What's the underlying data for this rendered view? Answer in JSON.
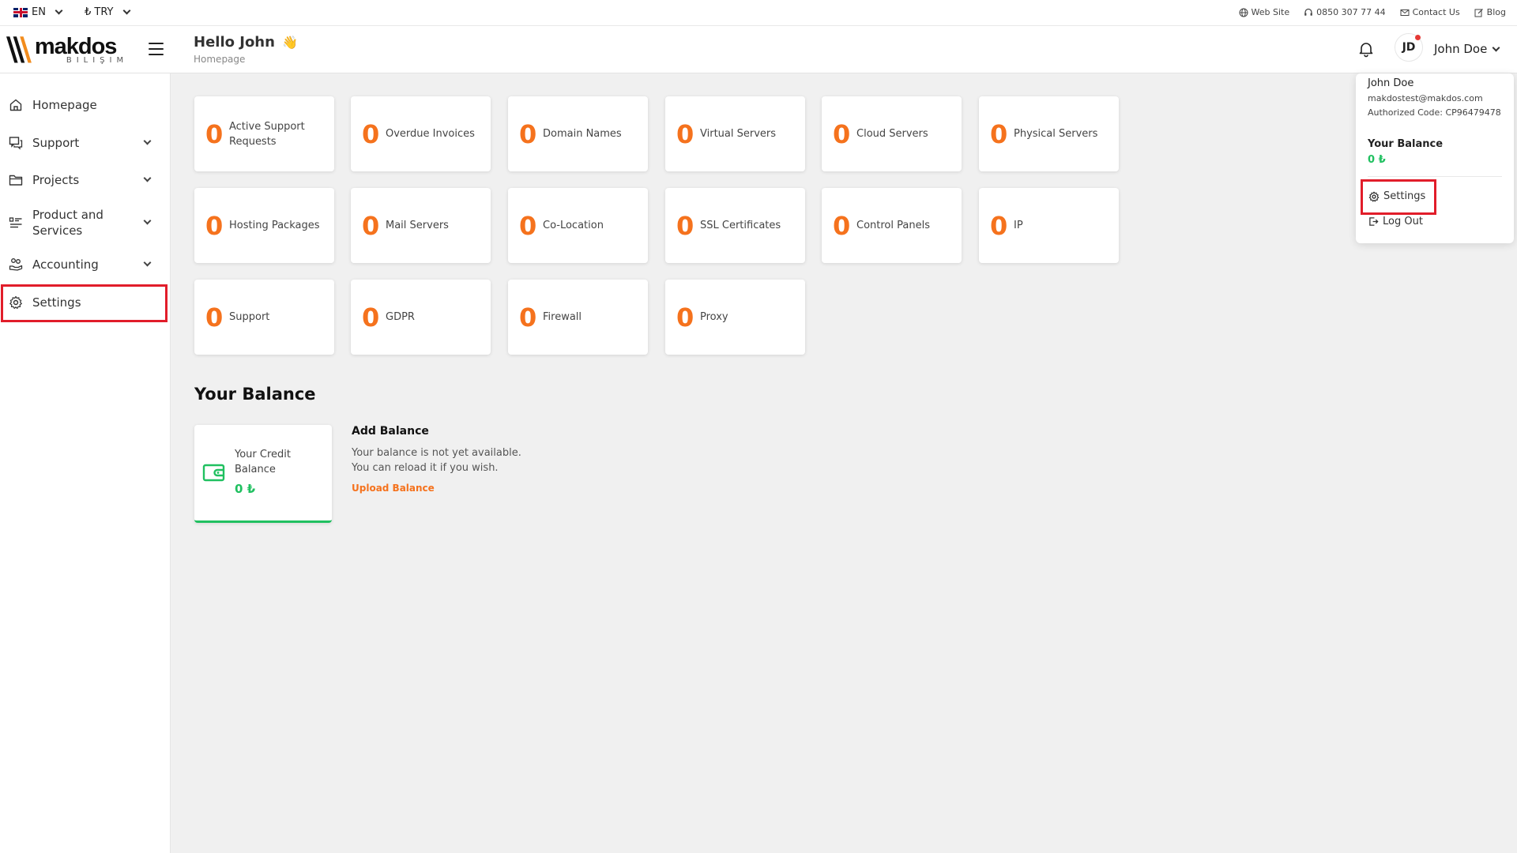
{
  "topbar": {
    "language": "EN",
    "currency": "₺ TRY",
    "links": {
      "website": "Web Site",
      "phone": "0850 307 77 44",
      "contact": "Contact Us",
      "blog": "Blog"
    }
  },
  "header": {
    "logo_brand": "makdos",
    "logo_sub": "BILIŞIM",
    "greeting": "Hello John",
    "greeting_emoji": "👋",
    "breadcrumb": "Homepage",
    "avatar_initials": "JD",
    "user_name": "John Doe"
  },
  "sidebar": {
    "items": [
      {
        "label": "Homepage",
        "icon": "home-icon",
        "has_submenu": false
      },
      {
        "label": "Support",
        "icon": "chat-icon",
        "has_submenu": true
      },
      {
        "label": "Projects",
        "icon": "folder-icon",
        "has_submenu": true
      },
      {
        "label": "Product and Services",
        "icon": "list-icon",
        "has_submenu": true
      },
      {
        "label": "Accounting",
        "icon": "coins-hand-icon",
        "has_submenu": true
      },
      {
        "label": "Settings",
        "icon": "gear-icon",
        "has_submenu": false,
        "highlighted": true
      }
    ]
  },
  "stats": [
    {
      "value": "0",
      "label": "Active Support Requests"
    },
    {
      "value": "0",
      "label": "Overdue Invoices"
    },
    {
      "value": "0",
      "label": "Domain Names"
    },
    {
      "value": "0",
      "label": "Virtual Servers"
    },
    {
      "value": "0",
      "label": "Cloud Servers"
    },
    {
      "value": "0",
      "label": "Physical Servers"
    },
    {
      "value": "0",
      "label": "Hosting Packages"
    },
    {
      "value": "0",
      "label": "Mail Servers"
    },
    {
      "value": "0",
      "label": "Co-Location"
    },
    {
      "value": "0",
      "label": "SSL Certificates"
    },
    {
      "value": "0",
      "label": "Control Panels"
    },
    {
      "value": "0",
      "label": "IP"
    },
    {
      "value": "0",
      "label": "Support"
    },
    {
      "value": "0",
      "label": "GDPR"
    },
    {
      "value": "0",
      "label": "Firewall"
    },
    {
      "value": "0",
      "label": "Proxy"
    }
  ],
  "balance": {
    "section_title": "Your Balance",
    "card_title": "Your Credit Balance",
    "card_value": "0 ₺",
    "add_title": "Add Balance",
    "add_desc_1": "Your balance is not yet available.",
    "add_desc_2": "You can reload it if you wish.",
    "upload_link": "Upload Balance"
  },
  "user_menu": {
    "name": "John Doe",
    "email": "makdostest@makdos.com",
    "code": "Authorized Code: CP96479478",
    "balance_title": "Your Balance",
    "balance_value": "0 ₺",
    "settings": "Settings",
    "logout": "Log Out"
  },
  "colors": {
    "accent_orange": "#f5721d",
    "success_green": "#20c060",
    "highlight_red": "#e11d2a"
  }
}
